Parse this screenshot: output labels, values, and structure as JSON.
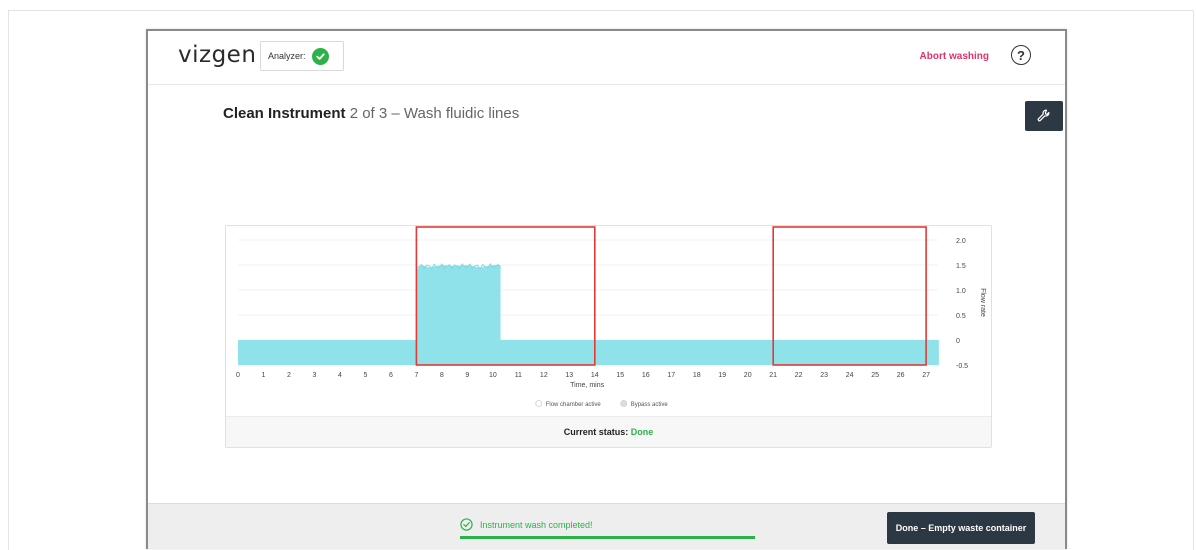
{
  "header": {
    "logo": "vizgen",
    "analyzer_label": "Analyzer:",
    "abort_label": "Abort washing",
    "help_glyph": "?"
  },
  "page": {
    "title_strong": "Clean Instrument",
    "title_rest": "2 of 3 – Wash fluidic lines"
  },
  "chart": {
    "status_label": "Current status:",
    "status_value": "Done",
    "status_color": "#2bb34a",
    "fill_color": "#8fe2ea",
    "highlight_color": "#e53935"
  },
  "chart_data": {
    "type": "area",
    "title": "",
    "xlabel": "Time, mins",
    "ylabel": "Flow rate",
    "xlim": [
      0,
      27
    ],
    "ylim": [
      -0.5,
      2.0
    ],
    "x_ticks": [
      0,
      1,
      2,
      3,
      4,
      5,
      6,
      7,
      8,
      9,
      10,
      11,
      12,
      13,
      14,
      15,
      16,
      17,
      18,
      19,
      20,
      21,
      22,
      23,
      24,
      25,
      26,
      27
    ],
    "y_ticks": [
      -0.5,
      0,
      0.5,
      1.0,
      1.5,
      2.0
    ],
    "y_tick_labels": [
      "-0.5",
      "0",
      "0.5",
      "1.0",
      "1.5",
      "2.0"
    ],
    "y_axis_position": "right",
    "grid": true,
    "legend": {
      "placement": "bottom-center",
      "entries": [
        "Flow chamber active",
        "Bypass active"
      ]
    },
    "series": [
      {
        "name": "Flow chamber active",
        "x": [
          0,
          7.0,
          7.0,
          7.2,
          7.5,
          8.0,
          8.5,
          9.0,
          9.5,
          10.0,
          10.3,
          10.3,
          27.5
        ],
        "y": [
          0,
          0,
          1.4,
          1.5,
          1.45,
          1.5,
          1.48,
          1.5,
          1.45,
          1.5,
          1.5,
          0,
          0
        ]
      }
    ],
    "highlight_regions": [
      {
        "x_range": [
          7.0,
          14.0
        ],
        "y_range": [
          -0.5,
          2.0
        ]
      },
      {
        "x_range": [
          21.0,
          27.0
        ],
        "y_range": [
          -0.5,
          2.0
        ]
      }
    ]
  },
  "footer": {
    "complete_msg": "Instrument wash completed!",
    "done_button": "Done – Empty waste container",
    "progress": 1.0
  },
  "icons": {
    "analyzer_status": "check-circle-icon",
    "help": "help-circle-icon",
    "tool": "wrench-icon",
    "complete": "check-circle-outline-icon"
  }
}
